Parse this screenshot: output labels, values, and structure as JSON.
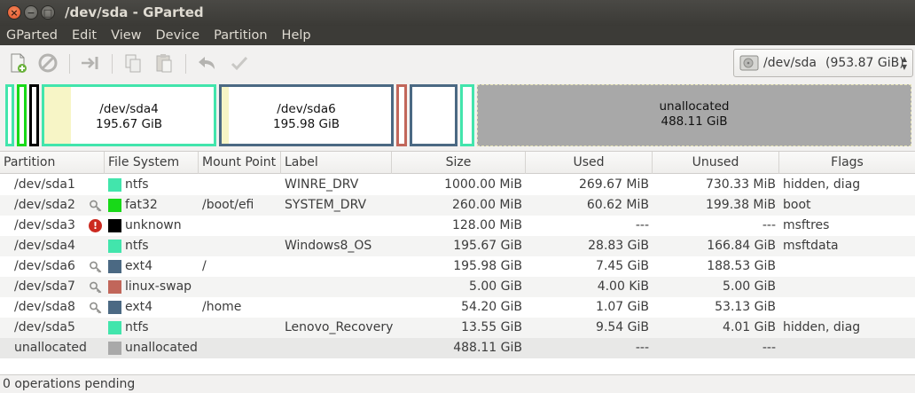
{
  "window": {
    "title": "/dev/sda - GParted"
  },
  "menu": [
    "GParted",
    "Edit",
    "View",
    "Device",
    "Partition",
    "Help"
  ],
  "toolbar_icons": [
    "new-partition-icon",
    "delete-icon",
    "resize-move-icon",
    "copy-icon",
    "paste-icon",
    "undo-icon",
    "apply-icon"
  ],
  "device": {
    "name": "/dev/sda",
    "size": "(953.87 GiB)"
  },
  "visual": {
    "sda4": {
      "name": "/dev/sda4",
      "size": "195.67 GiB"
    },
    "sda6": {
      "name": "/dev/sda6",
      "size": "195.98 GiB"
    },
    "unallocated": {
      "name": "unallocated",
      "size": "488.11 GiB"
    }
  },
  "table": {
    "headers": [
      "Partition",
      "File System",
      "Mount Point",
      "Label",
      "Size",
      "Used",
      "Unused",
      "Flags"
    ],
    "rows": [
      {
        "partition": "/dev/sda1",
        "fs": "ntfs",
        "fs_color": "#42e5ac",
        "mount": "",
        "label": "WINRE_DRV",
        "size": "1000.00 MiB",
        "used": "269.67 MiB",
        "unused": "730.33 MiB",
        "flags": "hidden, diag",
        "icon": ""
      },
      {
        "partition": "/dev/sda2",
        "fs": "fat32",
        "fs_color": "#18d918",
        "mount": "/boot/efi",
        "label": "SYSTEM_DRV",
        "size": "260.00 MiB",
        "used": "60.62 MiB",
        "unused": "199.38 MiB",
        "flags": "boot",
        "icon": "key-icon"
      },
      {
        "partition": "/dev/sda3",
        "fs": "unknown",
        "fs_color": "#000000",
        "mount": "",
        "label": "",
        "size": "128.00 MiB",
        "used": "---",
        "unused": "---",
        "flags": "msftres",
        "icon": "warning-icon"
      },
      {
        "partition": "/dev/sda4",
        "fs": "ntfs",
        "fs_color": "#42e5ac",
        "mount": "",
        "label": "Windows8_OS",
        "size": "195.67 GiB",
        "used": "28.83 GiB",
        "unused": "166.84 GiB",
        "flags": "msftdata",
        "icon": ""
      },
      {
        "partition": "/dev/sda6",
        "fs": "ext4",
        "fs_color": "#4b6983",
        "mount": "/",
        "label": "",
        "size": "195.98 GiB",
        "used": "7.45 GiB",
        "unused": "188.53 GiB",
        "flags": "",
        "icon": "key-icon"
      },
      {
        "partition": "/dev/sda7",
        "fs": "linux-swap",
        "fs_color": "#c1665a",
        "mount": "",
        "label": "",
        "size": "5.00 GiB",
        "used": "4.00 KiB",
        "unused": "5.00 GiB",
        "flags": "",
        "icon": "key-icon"
      },
      {
        "partition": "/dev/sda8",
        "fs": "ext4",
        "fs_color": "#4b6983",
        "mount": "/home",
        "label": "",
        "size": "54.20 GiB",
        "used": "1.07 GiB",
        "unused": "53.13 GiB",
        "flags": "",
        "icon": "key-icon"
      },
      {
        "partition": "/dev/sda5",
        "fs": "ntfs",
        "fs_color": "#42e5ac",
        "mount": "",
        "label": "Lenovo_Recovery",
        "size": "13.55 GiB",
        "used": "9.54 GiB",
        "unused": "4.01 GiB",
        "flags": "hidden, diag",
        "icon": ""
      },
      {
        "partition": "unallocated",
        "fs": "unallocated",
        "fs_color": "#a9a9a9",
        "mount": "",
        "label": "",
        "size": "488.11 GiB",
        "used": "---",
        "unused": "---",
        "flags": "",
        "icon": ""
      }
    ]
  },
  "status": "0 operations pending",
  "colors": {
    "ntfs": "#42e5ac",
    "fat32": "#18d918",
    "ext4": "#4b6983",
    "swap": "#c1665a",
    "unallocated": "#a9a9a9"
  }
}
